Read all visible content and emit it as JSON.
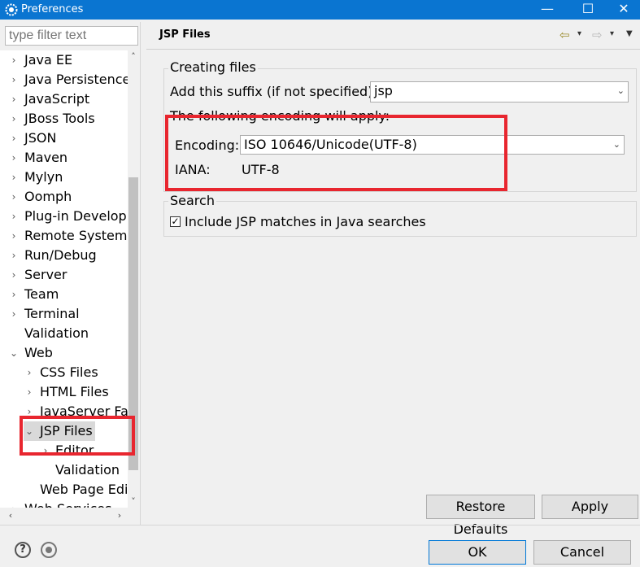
{
  "window": {
    "title": "Preferences",
    "minimize_glyph": "—",
    "maximize_glyph": "☐",
    "close_glyph": "✕"
  },
  "filter": {
    "placeholder": "type filter text"
  },
  "tree": {
    "items": [
      {
        "label": "Java EE",
        "twisty": "›"
      },
      {
        "label": "Java Persistence",
        "twisty": "›"
      },
      {
        "label": "JavaScript",
        "twisty": "›"
      },
      {
        "label": "JBoss Tools",
        "twisty": "›"
      },
      {
        "label": "JSON",
        "twisty": "›"
      },
      {
        "label": "Maven",
        "twisty": "›"
      },
      {
        "label": "Mylyn",
        "twisty": "›"
      },
      {
        "label": "Oomph",
        "twisty": "›"
      },
      {
        "label": "Plug-in Development",
        "twisty": "›"
      },
      {
        "label": "Remote Systems",
        "twisty": "›"
      },
      {
        "label": "Run/Debug",
        "twisty": "›"
      },
      {
        "label": "Server",
        "twisty": "›"
      },
      {
        "label": "Team",
        "twisty": "›"
      },
      {
        "label": "Terminal",
        "twisty": "›"
      },
      {
        "label": "Validation",
        "twisty": ""
      },
      {
        "label": "Web",
        "twisty": "⌄"
      },
      {
        "label": "CSS Files",
        "twisty": "›"
      },
      {
        "label": "HTML Files",
        "twisty": "›"
      },
      {
        "label": "JavaServer Faces",
        "twisty": "›"
      },
      {
        "label": "JSP Files",
        "twisty": "⌄"
      },
      {
        "label": "Editor",
        "twisty": "›"
      },
      {
        "label": "Validation",
        "twisty": ""
      },
      {
        "label": "Web Page Editor",
        "twisty": ""
      },
      {
        "label": "Web Services",
        "twisty": "›"
      }
    ]
  },
  "scrollbars": {
    "up": "˄",
    "down": "˅",
    "left": "‹",
    "right": "›"
  },
  "page": {
    "title": "JSP Files",
    "nav": {
      "back": "⇦",
      "forward": "⇨",
      "dropdown": "▾",
      "menu": "▼"
    }
  },
  "creating_files": {
    "legend": "Creating files",
    "suffix_label": "Add this suffix (if not specified):",
    "suffix_value": "jsp",
    "encoding_note": "The following encoding will apply:",
    "encoding_label": "Encoding:",
    "encoding_value": "ISO 10646/Unicode(UTF-8)",
    "iana_label": "IANA:",
    "iana_value": "UTF-8",
    "combo_arrow": "⌄"
  },
  "search": {
    "legend": "Search",
    "checkbox_label": "Include JSP matches in Java searches",
    "checked": "✓"
  },
  "buttons": {
    "restore_defaults": "Restore Defaults",
    "apply": "Apply",
    "ok": "OK",
    "cancel": "Cancel"
  },
  "footer": {
    "help_glyph": "?"
  },
  "colors": {
    "titlebar": "#0a75d1",
    "highlight_box": "#e8262f",
    "selection": "#d9d9d9"
  }
}
